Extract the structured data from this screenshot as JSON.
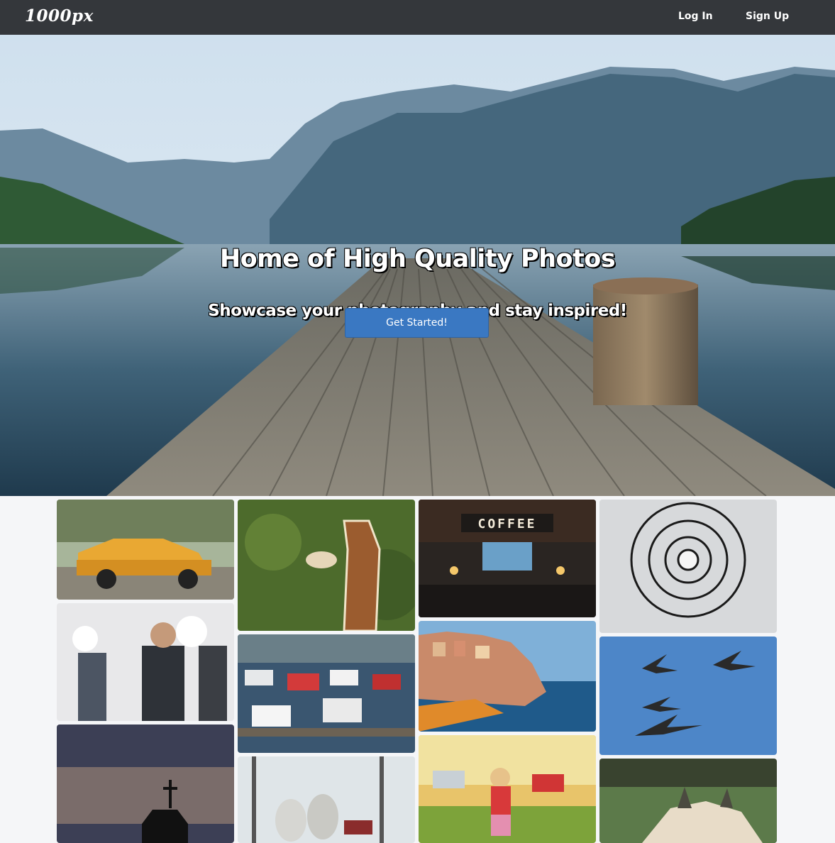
{
  "navbar": {
    "brand": "1000px",
    "login_label": "Log In",
    "signup_label": "Sign Up"
  },
  "hero": {
    "title": "Home of High Quality Photos",
    "subtitle": "Showcase your photography and stay inspired!",
    "cta_label": "Get Started!"
  },
  "gallery": {
    "coffee_sign": "COFFEE"
  },
  "colors": {
    "navbar_bg": "#34373b",
    "cta_bg": "#3a78c2",
    "page_bg": "#f5f6f8"
  }
}
